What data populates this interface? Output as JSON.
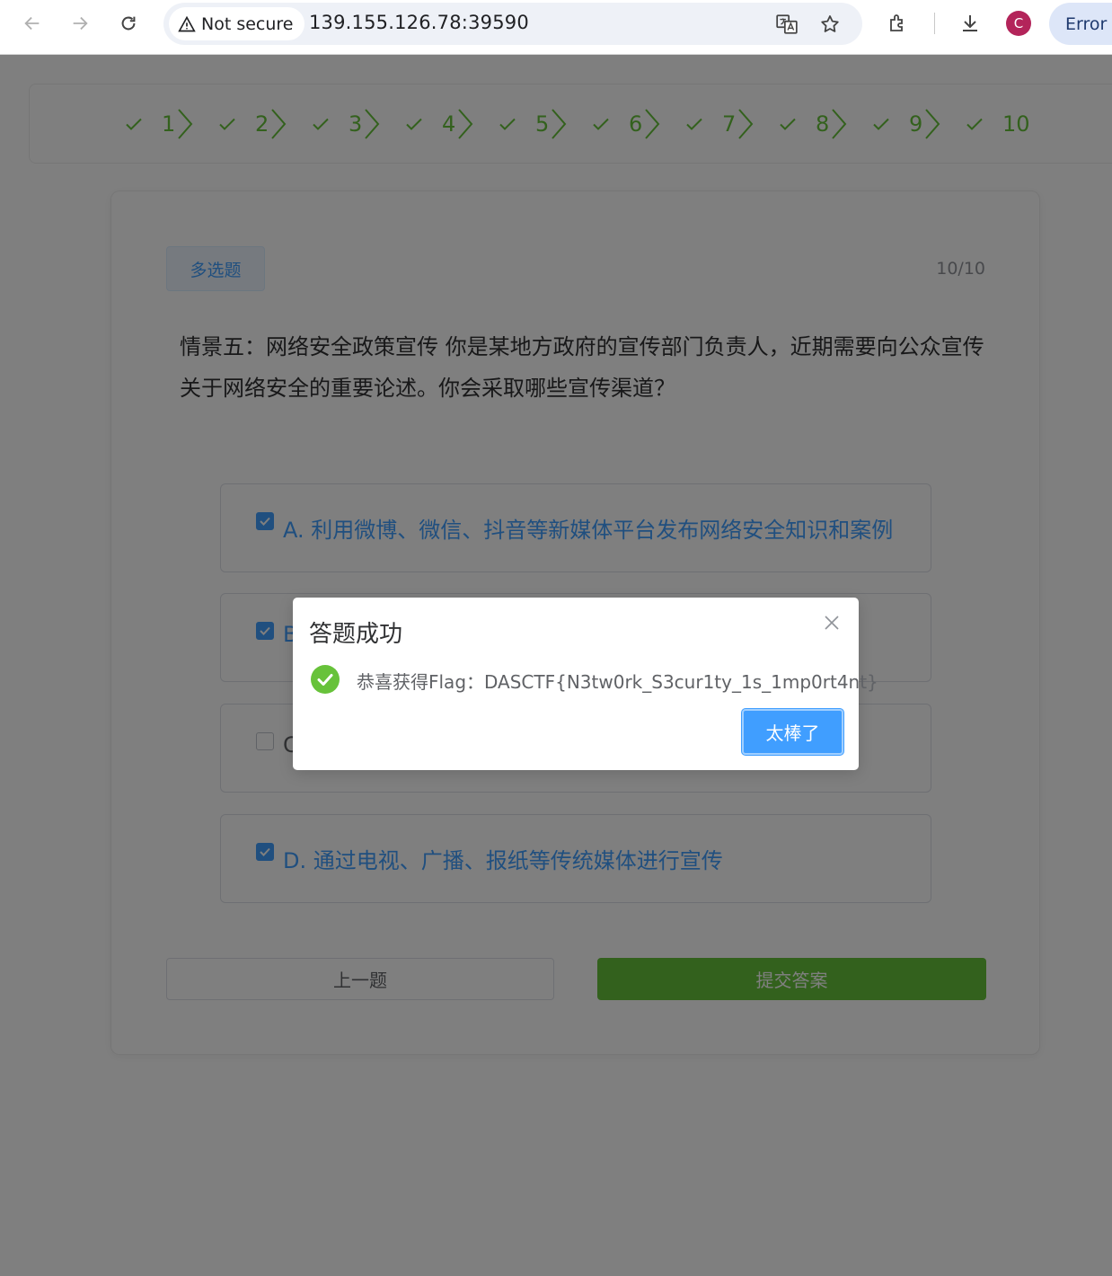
{
  "browser": {
    "security_label": "Not secure",
    "url": "139.155.126.78:39590",
    "profile_initial": "C",
    "error_label": "Error"
  },
  "steps": [
    "1",
    "2",
    "3",
    "4",
    "5",
    "6",
    "7",
    "8",
    "9",
    "10"
  ],
  "quiz": {
    "type_tag": "多选题",
    "progress": "10/10",
    "question": "情景五：网络安全政策宣传 你是某地方政府的宣传部门负责人，近期需要向公众宣传关于网络安全的重要论述。你会采取哪些宣传渠道？",
    "options": [
      {
        "label": "A. 利用微博、微信、抖音等新媒体平台发布网络安全知识和案例",
        "checked": true
      },
      {
        "label": "B",
        "checked": true
      },
      {
        "label": "C",
        "checked": false
      },
      {
        "label": "D. 通过电视、广播、报纸等传统媒体进行宣传",
        "checked": true
      }
    ],
    "prev_label": "上一题",
    "submit_label": "提交答案"
  },
  "dialog": {
    "title": "答题成功",
    "message": "恭喜获得Flag：DASCTF{N3tw0rk_S3cur1ty_1s_1mp0rt4nt}",
    "ok_label": "太棒了"
  },
  "colors": {
    "primary": "#409eff",
    "success": "#67c23a",
    "overlay": "rgba(0,0,0,0.5)"
  }
}
